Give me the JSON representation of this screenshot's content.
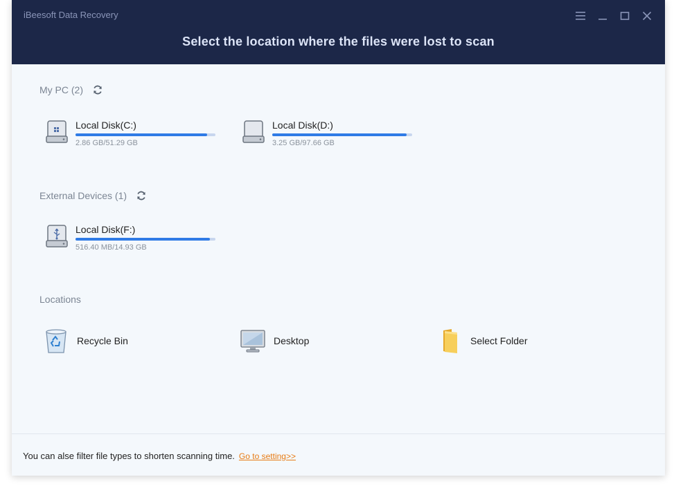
{
  "window": {
    "app_title": "iBeesoft Data Recovery",
    "headline": "Select the location where the files were lost to scan"
  },
  "sections": {
    "my_pc": {
      "title": "My PC (2)"
    },
    "external": {
      "title": "External Devices (1)"
    },
    "locations": {
      "title": "Locations"
    }
  },
  "drives": {
    "c": {
      "name": "Local Disk(C:)",
      "size": "2.86 GB/51.29 GB",
      "fill_pct": 94
    },
    "d": {
      "name": "Local Disk(D:)",
      "size": "3.25 GB/97.66 GB",
      "fill_pct": 96
    },
    "f": {
      "name": "Local Disk(F:)",
      "size": "516.40 MB/14.93 GB",
      "fill_pct": 96
    }
  },
  "locations": {
    "recycle_bin": {
      "label": "Recycle Bin",
      "icon": "recycle-bin-icon"
    },
    "desktop": {
      "label": "Desktop",
      "icon": "monitor-icon"
    },
    "select_folder": {
      "label": "Select Folder",
      "icon": "folder-icon"
    }
  },
  "footer": {
    "message": "You can alse filter file types to shorten scanning time.",
    "link": "Go to setting>>"
  },
  "colors": {
    "titlebar": "#1c2748",
    "accent": "#2f7be6",
    "link": "#e77b14"
  }
}
